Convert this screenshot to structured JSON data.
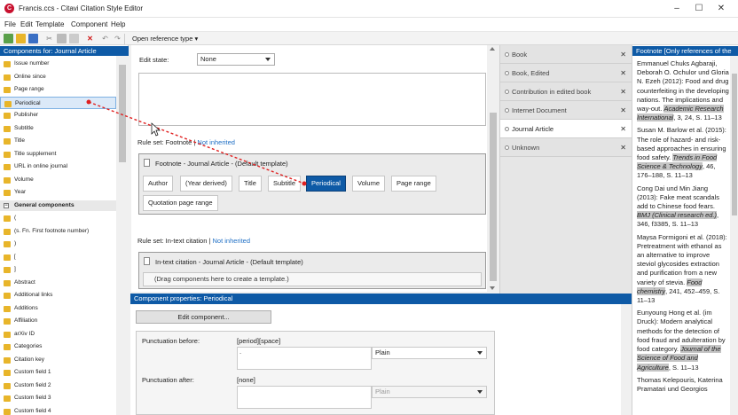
{
  "window": {
    "title": "Francis.ccs - Citavi Citation Style Editor",
    "minimize": "–",
    "maximize": "☐",
    "close": "✕",
    "app_icon": "citavi-logo"
  },
  "menu": [
    "File",
    "Edit",
    "Template",
    "Component",
    "Help"
  ],
  "toolbar": {
    "open_reference_type": "Open reference type"
  },
  "left_panel": {
    "header": "Components for: Journal Article",
    "components": [
      "Issue number",
      "Online since",
      "Page range",
      "Periodical",
      "Publisher",
      "Subtitle",
      "Title",
      "Title supplement",
      "URL in online journal",
      "Volume",
      "Year"
    ],
    "selected": "Periodical",
    "general_header": "General components",
    "general_components": [
      "(",
      "(s. Fn. First footnote number)",
      ")",
      "[",
      "]",
      "Abstract",
      "Additional links",
      "Additions",
      "Affiliation",
      "arXiv ID",
      "Categories",
      "Citation key",
      "Custom field 1",
      "Custom field 2",
      "Custom field 3",
      "Custom field 4"
    ]
  },
  "center": {
    "edit_state_label": "Edit state:",
    "edit_state_value": "None",
    "footnote_ruleset": {
      "label": "Rule set: Footnote",
      "link": "Not inherited"
    },
    "footnote_template": {
      "title": "Footnote - Journal Article - (Default template)",
      "chips_row1": [
        "Author",
        "(Year derived)",
        "Title",
        "Subtitle",
        "Periodical",
        "Volume",
        "Page range"
      ],
      "chips_row2": [
        "Quotation page range"
      ],
      "active_chip": "Periodical"
    },
    "intext_ruleset": {
      "label": "Rule set: In-text citation",
      "link": "Not inherited"
    },
    "intext_template": {
      "title": "In-text citation - Journal Article - (Default template)",
      "hint": "(Drag components here to create a template.)"
    }
  },
  "reference_types": {
    "items": [
      "Book",
      "Book, Edited",
      "Contribution in edited book",
      "Internet Document",
      "Journal Article",
      "Unknown"
    ],
    "active": "Journal Article"
  },
  "properties": {
    "header": "Component properties:  Periodical",
    "edit_button": "Edit component...",
    "punct_before_label": "Punctuation before:",
    "punct_before_value": "[period][space]",
    "punct_before_text": ".",
    "punct_before_style": "Plain",
    "punct_after_label": "Punctuation after:",
    "punct_after_value": "[none]",
    "punct_after_style": "Plain"
  },
  "preview": {
    "header": "Footnote [Only references of the",
    "entries": [
      {
        "text": "Emmanuel Chuks Agbaraji, Deborah O. Ochulor und Gloria N. Ezeh (2012): Food and drug counterfeiting in the developing nations. The implications and way-out.",
        "journal": "Academic Research International",
        "tail": ", 3, 24, S. 11–13"
      },
      {
        "text": "Susan M. Barlow et al. (2015): The role of hazard- and risk-based approaches in ensuring food safety.",
        "journal": "Trends in Food Science & Technology",
        "tail": ", 46, 176–188, S. 11–13"
      },
      {
        "text": "Cong Dai und Min Jiang (2013): Fake meat scandals add to Chinese food fears.",
        "journal": "BMJ (Clinical research ed.)",
        "tail": ", 346, f3385, S. 11–13"
      },
      {
        "text": "Maysa Formigoni et al. (2018): Pretreatment with ethanol as an alternative to improve steviol glycosides extraction and purification from a new variety of stevia.",
        "journal": "Food chemistry",
        "tail": ", 241, 452–459, S. 11–13"
      },
      {
        "text": "Eunyoung Hong et al. (im Druck): Modern analytical methods for the detection of food fraud and adulteration by food category.",
        "journal": "Journal of the Science of Food and Agriculture",
        "tail": ", S. 11–13"
      },
      {
        "text": "Thomas Kelepouris, Katerina Pramatari und Georgios",
        "journal": "",
        "tail": ""
      }
    ]
  },
  "colors": {
    "accent": "#0e5aa6",
    "drag_line": "#e02020",
    "folder": "#e8b52a"
  }
}
